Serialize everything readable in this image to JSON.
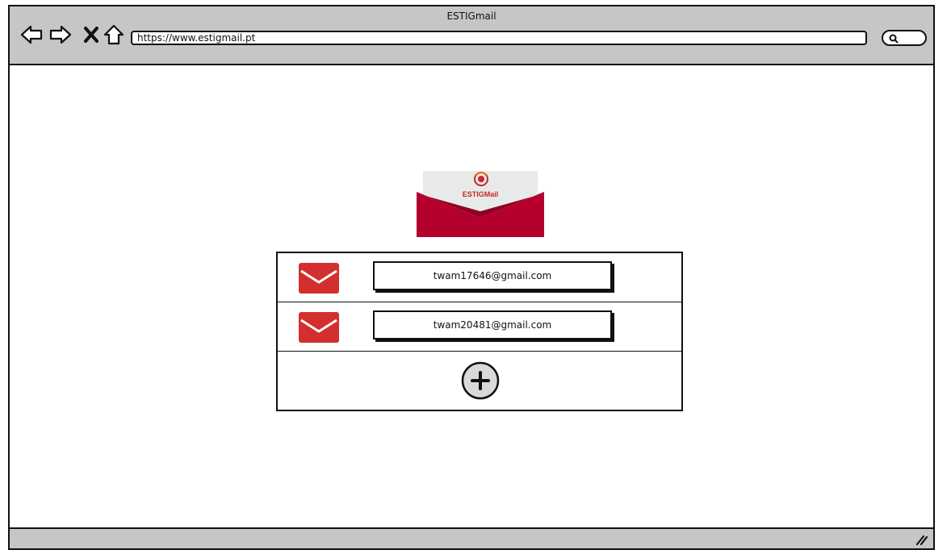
{
  "window": {
    "title": "ESTIGmail"
  },
  "nav": {
    "url": "https://www.estigmail.pt",
    "icons": [
      "arrow-left-icon",
      "arrow-right-icon",
      "close-icon",
      "home-icon",
      "search-icon"
    ]
  },
  "logo": {
    "text": "ESTIGMail",
    "colors": {
      "envelope": "#b5002e",
      "paper": "#e8eaea"
    }
  },
  "accounts": [
    {
      "email": "twam17646@gmail.com",
      "icon": "mail-icon"
    },
    {
      "email": "twam20481@gmail.com",
      "icon": "mail-icon"
    }
  ],
  "add_account": {
    "icon": "plus-circle-icon"
  },
  "colors": {
    "chrome": "#c6c6c6",
    "mail_icon": "#d32f2f"
  }
}
